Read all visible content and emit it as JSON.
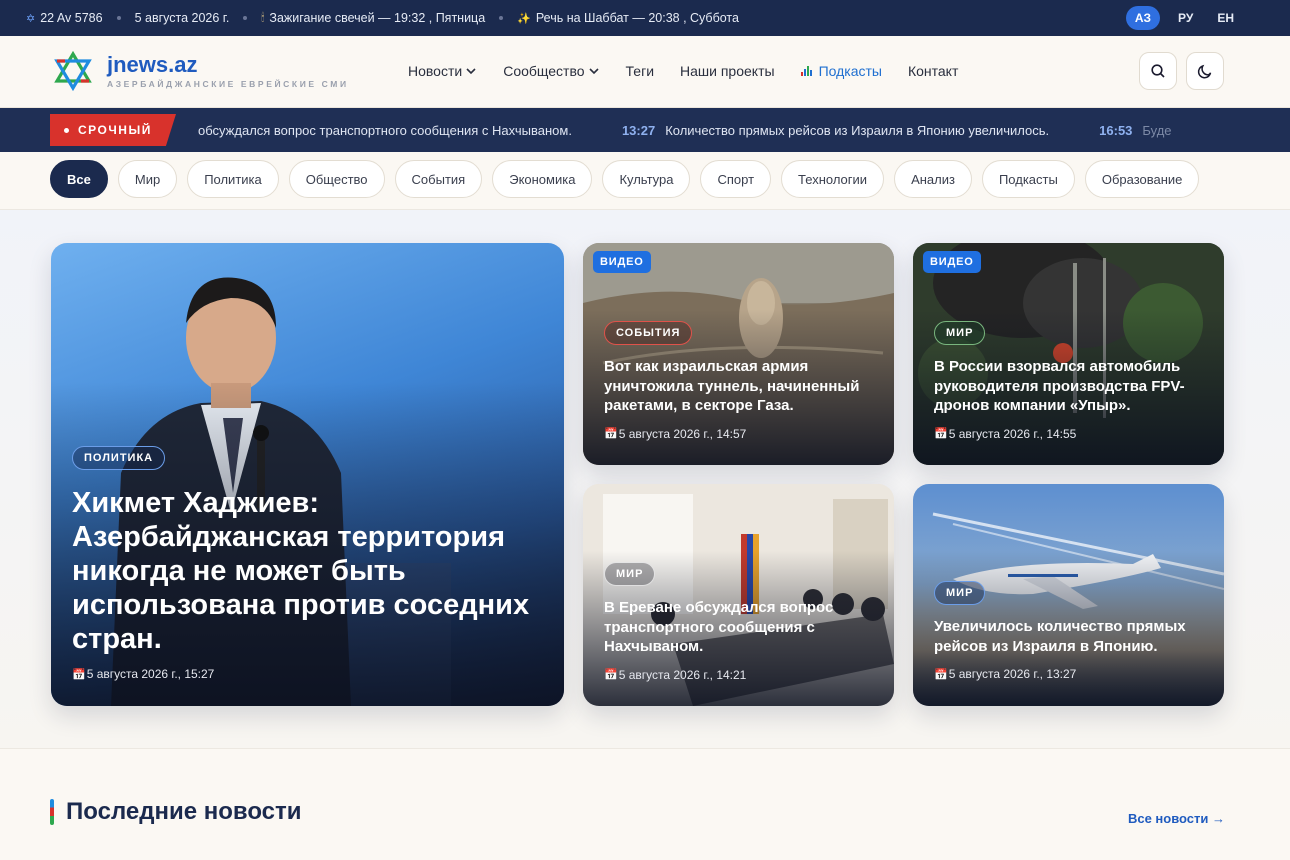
{
  "topbar": {
    "hebrew_date": "22 Av 5786",
    "date": "5 августа 2026 г.",
    "candles": "Зажигание свечей — 19:32 , Пятница",
    "havdalah": "Речь на Шаббат — 20:38 , Суббота",
    "languages": [
      "АЗ",
      "РУ",
      "ЕН"
    ],
    "active_language": "АЗ"
  },
  "header": {
    "brand": "jnews.az",
    "tagline": "АЗЕРБАЙДЖАНСКИЕ ЕВРЕЙСКИЕ СМИ",
    "nav": [
      {
        "label": "Новости",
        "dropdown": true
      },
      {
        "label": "Сообщество",
        "dropdown": true
      },
      {
        "label": "Теги",
        "dropdown": false
      },
      {
        "label": "Наши проекты",
        "dropdown": false
      },
      {
        "label": "Подкасты",
        "dropdown": false
      },
      {
        "label": "Контакт",
        "dropdown": false
      }
    ]
  },
  "ticker": {
    "label": "СРОЧНЫЙ",
    "items": [
      {
        "time": "",
        "text": "обсуждался вопрос транспортного сообщения с Нахчываном."
      },
      {
        "time": "13:27",
        "text": "Количество прямых рейсов из Израиля в Японию увеличилось."
      },
      {
        "time": "16:53",
        "text": "Буде"
      }
    ]
  },
  "categories": [
    "Все",
    "Мир",
    "Политика",
    "Общество",
    "События",
    "Экономика",
    "Культура",
    "Спорт",
    "Технологии",
    "Анализ",
    "Подкасты",
    "Образование"
  ],
  "hero": {
    "category": "ПОЛИТИКА",
    "title": "Хикмет Хаджиев: Азербайджанская территория никогда не может быть использована против соседних стран.",
    "date": "5 августа 2026 г., 15:27"
  },
  "cards": [
    {
      "video": "ВИДЕО",
      "category": "СОБЫТИЯ",
      "title": "Вот как израильская армия уничтожила туннель, начиненный ракетами, в секторе Газа.",
      "date": "5 августа 2026 г., 14:57"
    },
    {
      "video": "ВИДЕО",
      "category": "МИР",
      "title": "В России взорвался автомобиль руководителя производства FPV-дронов компании «Упыр».",
      "date": "5 августа 2026 г., 14:55"
    },
    {
      "video": "",
      "category": "МИР",
      "title": "В Ереване обсуждался вопрос транспортного сообщения с Нахчываном.",
      "date": "5 августа 2026 г., 14:21"
    },
    {
      "video": "",
      "category": "МИР",
      "title": "Увеличилось количество прямых рейсов из Израиля в Японию.",
      "date": "5 августа 2026 г., 13:27"
    }
  ],
  "latest": {
    "title": "Последние новости",
    "all_link": "Все новости →"
  },
  "colors": {
    "navy": "#1b2a4e",
    "accent_blue": "#1f6fe0",
    "breaking_red": "#d8322c"
  }
}
